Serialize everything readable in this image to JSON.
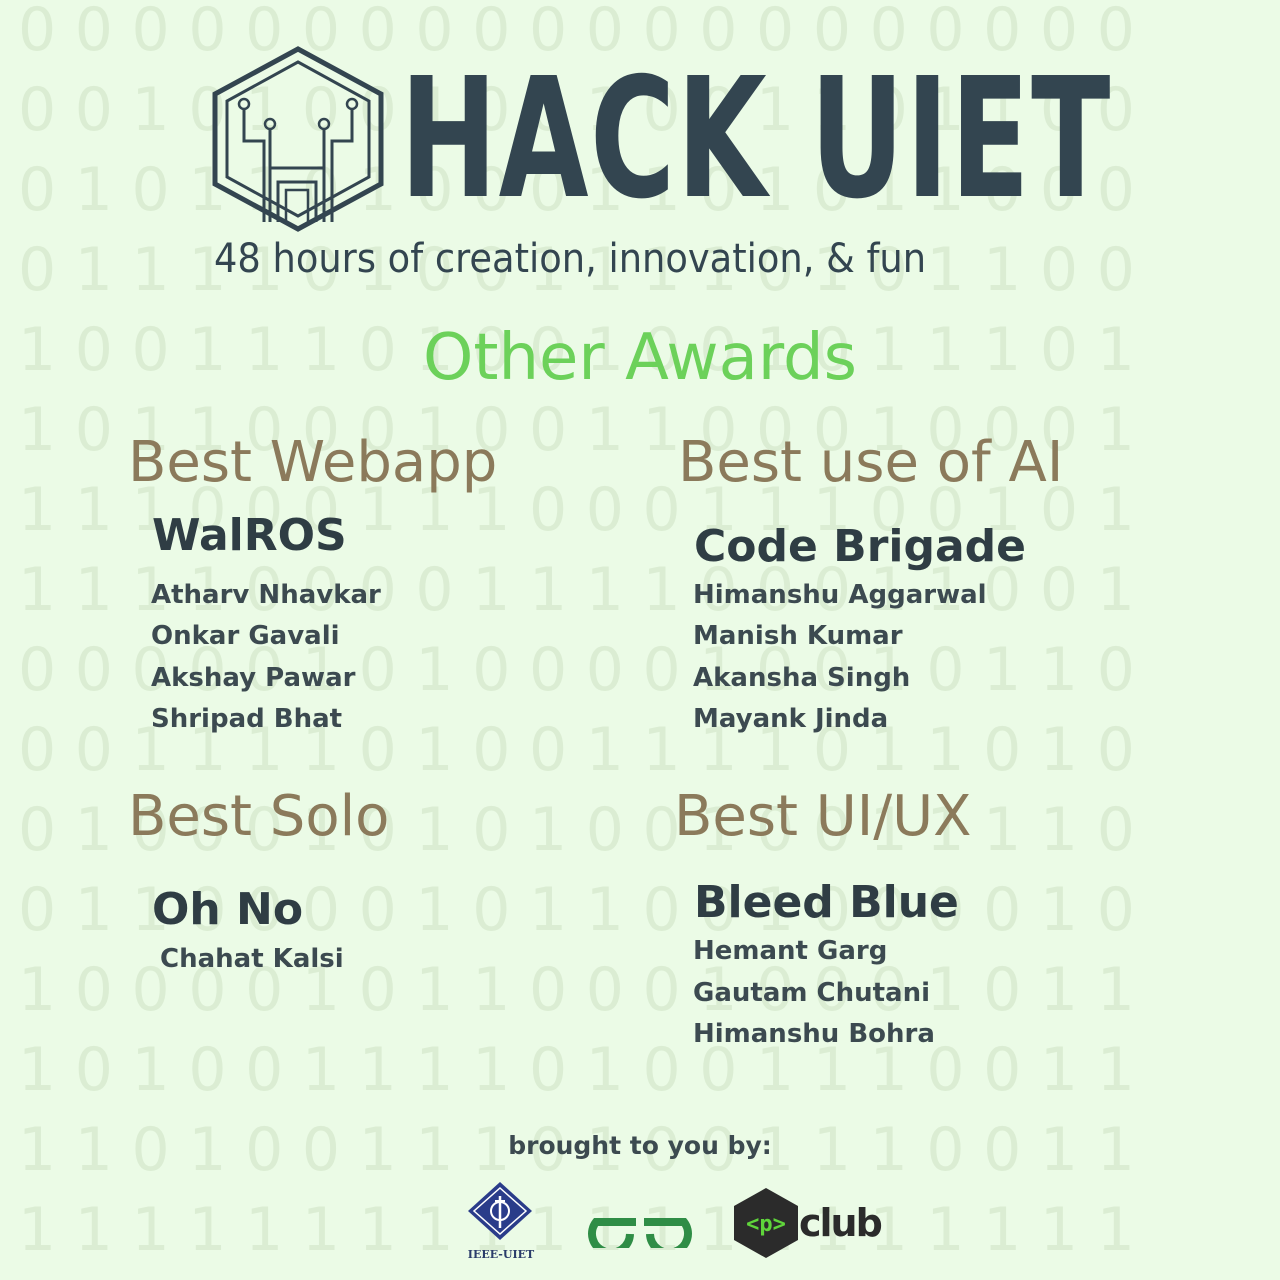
{
  "background": {
    "color": "#ebfbe6",
    "digit_color": "#dbedd3",
    "rows": [
      "00000000000000000000",
      "00101001001001101100",
      "01011010001101011000",
      "01111010011110101100",
      "10011101001001011101",
      "10110001001100010001",
      "11100011100011100101",
      "11110000111100011001",
      "00000101000010010110",
      "00111101001111011010",
      "01000101010010011110",
      "01100001011001000010",
      "10000101100010001011",
      "10100111101001110011",
      "11010011101001110011",
      "11111111111111111111"
    ]
  },
  "header": {
    "logo_icon": "hexagon-circuit-h-icon",
    "title": "HACK UIET",
    "tagline": "48 hours of creation, innovation, & fun",
    "title_color": "#334550"
  },
  "heading": {
    "text": "Other Awards",
    "color": "#6cd15a"
  },
  "award_title_color": "#8b7a5b",
  "awards": [
    {
      "title": "Best Webapp",
      "team": "WalROS",
      "members": [
        "Atharv Nhavkar",
        "Onkar Gavali",
        "Akshay Pawar",
        "Shripad Bhat"
      ]
    },
    {
      "title": "Best use of AI",
      "team": "Code Brigade",
      "members": [
        "Himanshu Aggarwal",
        "Manish Kumar",
        "Akansha Singh",
        "Mayank Jinda"
      ]
    },
    {
      "title": "Best Solo",
      "team": "Oh No",
      "members": [
        "Chahat Kalsi"
      ]
    },
    {
      "title": "Best UI/UX",
      "team": "Bleed Blue",
      "members": [
        "Hemant Garg",
        "Gautam Chutani",
        "Himanshu Bohra"
      ]
    }
  ],
  "footer": {
    "credit": "brought to you by:",
    "sponsors": [
      {
        "name": "IEEE-UIET",
        "icon": "ieee-diamond-icon",
        "color": "#2a3c8a"
      },
      {
        "name": "GeeksforGeeks",
        "icon": "gfg-logo-icon",
        "color": "#2f8d46"
      },
      {
        "name": "club",
        "badge": "<p>",
        "icon": "programming-club-hexagon-icon",
        "color": "#2b2b2b",
        "accent": "#5fd53b"
      }
    ]
  }
}
